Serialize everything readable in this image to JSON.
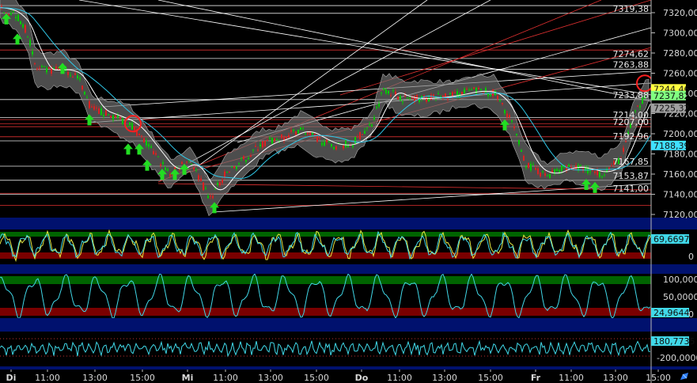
{
  "chart_data": [
    {
      "type": "line",
      "panel": "price",
      "subtype": "candlestick",
      "y_ticks": [
        7320,
        7300,
        7280,
        7260,
        7240,
        7220,
        7200,
        7180,
        7160,
        7140,
        7120
      ],
      "y_tick_labels": [
        "7320,00",
        "7300,00",
        "7280,00",
        "7260,00",
        "7240,00",
        "7220,00",
        "7200,00",
        "7180,00",
        "7160,00",
        "7140,00",
        "7120,00"
      ],
      "ylim": [
        7112,
        7331
      ],
      "price_tags": [
        {
          "value": 7244.46,
          "label": "7244,46",
          "color": "#ffff40"
        },
        {
          "value": 7237.82,
          "label": "7237,82",
          "color": "#80ff80"
        },
        {
          "value": 7225.32,
          "label": "7225,32",
          "color": "#a0a0a0"
        },
        {
          "value": 7188.39,
          "label": "7188,39",
          "color": "#40e0ff"
        }
      ],
      "levels": [
        {
          "value": 7319.38,
          "label": "7319,38",
          "color": "#e8e8e8"
        },
        {
          "value": 7274.62,
          "label": "7274,62",
          "color": "#e8e8e8"
        },
        {
          "value": 7263.88,
          "label": "7263,88",
          "color": "#e8e8e8"
        },
        {
          "value": 7233.88,
          "label": "7233,88",
          "color": "#e8e8e8"
        },
        {
          "value": 7214.0,
          "label": "7214,00",
          "color": "#e03030"
        },
        {
          "value": 7207.0,
          "label": "7207,00",
          "color": "#e03030"
        },
        {
          "value": 7192.96,
          "label": "7192,96",
          "color": "#e8e8e8"
        },
        {
          "value": 7167.85,
          "label": "7167,85",
          "color": "#e8e8e8"
        },
        {
          "value": 7153.87,
          "label": "7153,87",
          "color": "#e8e8e8"
        },
        {
          "value": 7141.0,
          "label": "7141,00",
          "color": "#e03030"
        }
      ],
      "extra_hlines": [
        {
          "value": 7327,
          "color": "#e8e8e8"
        },
        {
          "value": 7289,
          "color": "#e8e8e8"
        },
        {
          "value": 7283,
          "color": "#e03030"
        },
        {
          "value": 7216,
          "color": "#e8e8e8"
        },
        {
          "value": 7210,
          "color": "#e03030"
        },
        {
          "value": 7197,
          "color": "#e03030"
        },
        {
          "value": 7140,
          "color": "#e8e8e8"
        },
        {
          "value": 7129,
          "color": "#e03030"
        }
      ],
      "buy_arrows": [
        {
          "x": 8,
          "price": 7313
        },
        {
          "x": 22,
          "price": 7293
        },
        {
          "x": 79,
          "price": 7264
        },
        {
          "x": 113,
          "price": 7213
        },
        {
          "x": 162,
          "price": 7184
        },
        {
          "x": 176,
          "price": 7184
        },
        {
          "x": 186,
          "price": 7168
        },
        {
          "x": 205,
          "price": 7159
        },
        {
          "x": 221,
          "price": 7159
        },
        {
          "x": 233,
          "price": 7164
        },
        {
          "x": 271,
          "price": 7126
        },
        {
          "x": 638,
          "price": 7208
        },
        {
          "x": 741,
          "price": 7149
        },
        {
          "x": 752,
          "price": 7146
        }
      ],
      "circles": [
        {
          "x": 168,
          "price": 7210
        },
        {
          "x": 815,
          "price": 7250
        }
      ]
    },
    {
      "type": "line",
      "panel": "oscillator-1",
      "last_value_label": "69,6697",
      "y_ticks": [
        0
      ],
      "y_tick_labels": [
        "0"
      ],
      "ylim": [
        0,
        100
      ],
      "band_colors": {
        "upper": "#006400",
        "lower": "#7a0000"
      }
    },
    {
      "type": "line",
      "panel": "oscillator-2",
      "last_value_label": "24,9644",
      "y_ticks": [
        100,
        50,
        0
      ],
      "y_tick_labels": [
        "100,0000",
        "50,0000",
        "0"
      ],
      "ylim": [
        0,
        100
      ],
      "band_colors": {
        "upper": "#006400",
        "lower": "#7a0000"
      }
    },
    {
      "type": "line",
      "panel": "oscillator-3",
      "last_value_label": "180,7735",
      "y_ticks": [
        -200
      ],
      "y_tick_labels": [
        "-200,0000"
      ],
      "ylim": [
        -260,
        260
      ]
    }
  ],
  "x_axis": {
    "ticks": [
      {
        "label": "Di",
        "bold": true,
        "x": 14
      },
      {
        "label": "11:00",
        "x": 60
      },
      {
        "label": "13:00",
        "x": 120
      },
      {
        "label": "15:00",
        "x": 180
      },
      {
        "label": "Mi",
        "bold": true,
        "x": 237
      },
      {
        "label": "11:00",
        "x": 285
      },
      {
        "label": "13:00",
        "x": 342
      },
      {
        "label": "15:00",
        "x": 400
      },
      {
        "label": "Do",
        "bold": true,
        "x": 457
      },
      {
        "label": "11:00",
        "x": 505
      },
      {
        "label": "13:00",
        "x": 562
      },
      {
        "label": "15:00",
        "x": 620
      },
      {
        "label": "Fr",
        "bold": true,
        "x": 677
      },
      {
        "label": "11:00",
        "x": 722
      },
      {
        "label": "13:00",
        "x": 778
      },
      {
        "label": "15:00",
        "x": 832
      }
    ]
  },
  "colors": {
    "background": "#000000",
    "panel_separator": "#00116e",
    "candle_up": "#00cc00",
    "candle_down": "#dd2020",
    "bollinger_fill": "#777777",
    "ma_white": "#ffffff",
    "ma_cyan": "#30c8e8",
    "arrow": "#22dd22",
    "osc_yellow": "#e8e840",
    "osc_cyan": "#40d8e8"
  },
  "icons": {
    "corner": "pen-icon"
  }
}
